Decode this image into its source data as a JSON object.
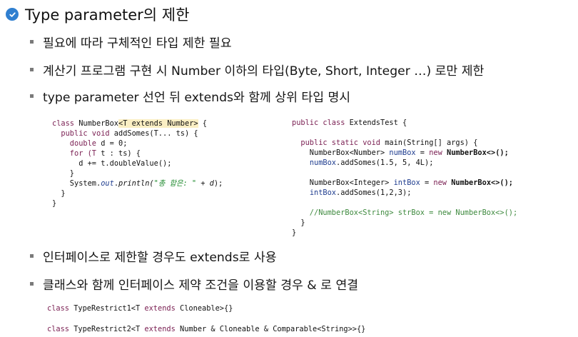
{
  "heading": {
    "text": "Type parameter의 제한",
    "icon": "checkmark-circle-icon",
    "icon_color": "#2f7fd0"
  },
  "bullets_top": [
    "필요에 따라 구체적인 타입 제한 필요",
    "계산기 프로그램 구현 시 Number 이하의 타입(Byte, Short, Integer …) 로만 제한",
    "type parameter 선언 뒤 extends와 함께 상위 타입 명시"
  ],
  "code_left": {
    "l1": {
      "a": "class ",
      "b": "NumberBox",
      "c": "<T extends Number>",
      "d": " {"
    },
    "l2": {
      "a": "  public void ",
      "b": "addSomes",
      "c": "(T... ts) {"
    },
    "l3": {
      "a": "    double ",
      "b": "d",
      "c": " = 0;"
    },
    "l4": {
      "a": "    for (T ",
      "b": "t",
      "c": " : ts) {"
    },
    "l5": {
      "a": "      ",
      "b": "d",
      "c": " += ",
      "d": "t",
      "e": ".doubleValue();"
    },
    "l6": "    }",
    "l7": {
      "a": "    System.",
      "b": "out",
      "c": ".",
      "d": "println(",
      "e": "\"총 합은: \"",
      "f": " + ",
      "g": "d",
      "h": ");"
    },
    "l8": "  }",
    "l9": "}"
  },
  "code_right": {
    "l1": {
      "a": "public class ",
      "b": "ExtendsTest",
      "c": " {"
    },
    "l2": {
      "a": "  public static void ",
      "b": "main",
      "c": "(String[] args) {"
    },
    "l3": {
      "a": "    NumberBox<Number> ",
      "b": "numBox",
      "c": " = ",
      "d": "new ",
      "e": "NumberBox<>();"
    },
    "l4": {
      "a": "    ",
      "b": "numBox",
      "c": ".addSomes(1.5, 5, 4L);"
    },
    "l5": {
      "a": "    NumberBox<Integer> ",
      "b": "intBox",
      "c": " = ",
      "d": "new ",
      "e": "NumberBox<>();"
    },
    "l6": {
      "a": "    ",
      "b": "intBox",
      "c": ".addSomes(1,2,3);"
    },
    "l7": "    //NumberBox<String> strBox = new NumberBox<>();",
    "l8": "  }",
    "l9": "}"
  },
  "bullets_bottom": [
    "인터페이스로 제한할 경우도 extends로 사용",
    "클래스와 함께 인터페이스 제약 조건을 이용할 경우 & 로 연결"
  ],
  "code_bottom": {
    "l1": {
      "a": "class ",
      "b": "TypeRestrict1<T ",
      "c": "extends ",
      "d": "Cloneable>{}"
    },
    "l2": {
      "a": "class ",
      "b": "TypeRestrict2<T ",
      "c": "extends ",
      "d": "Number & Cloneable & Comparable<String>>{}"
    }
  }
}
